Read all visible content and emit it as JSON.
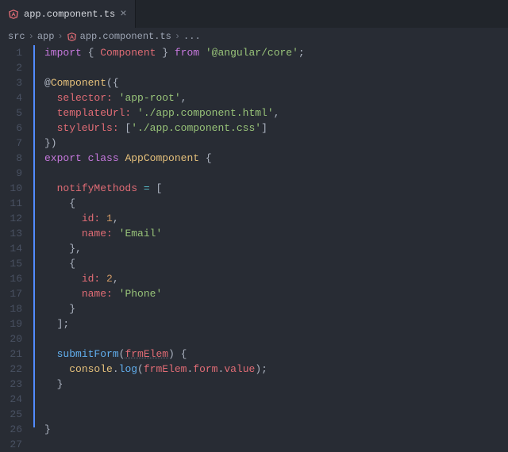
{
  "tab": {
    "filename": "app.component.ts"
  },
  "breadcrumb": {
    "seg1": "src",
    "seg2": "app",
    "seg3": "app.component.ts",
    "more": "..."
  },
  "lines": {
    "l1": {
      "a": "import",
      "b": " { ",
      "c": "Component",
      "d": " } ",
      "e": "from",
      "f": " ",
      "g": "'@angular/core'",
      "h": ";"
    },
    "l3": {
      "a": "@",
      "b": "Component",
      "c": "({"
    },
    "l4": {
      "a": "  selector:",
      "b": " ",
      "c": "'app-root'",
      "d": ","
    },
    "l5": {
      "a": "  templateUrl:",
      "b": " ",
      "c": "'./app.component.html'",
      "d": ","
    },
    "l6": {
      "a": "  styleUrls:",
      "b": " [",
      "c": "'./app.component.css'",
      "d": "]"
    },
    "l7": {
      "a": "})"
    },
    "l8": {
      "a": "export",
      "b": " ",
      "c": "class",
      "d": " ",
      "e": "AppComponent",
      "f": " {"
    },
    "l10": {
      "a": "  ",
      "b": "notifyMethods",
      "c": " ",
      "d": "=",
      "e": " ["
    },
    "l11": {
      "a": "    {"
    },
    "l12": {
      "a": "      ",
      "b": "id:",
      "c": " ",
      "d": "1",
      "e": ","
    },
    "l13": {
      "a": "      ",
      "b": "name:",
      "c": " ",
      "d": "'Email'"
    },
    "l14": {
      "a": "    },"
    },
    "l15": {
      "a": "    {"
    },
    "l16": {
      "a": "      ",
      "b": "id:",
      "c": " ",
      "d": "2",
      "e": ","
    },
    "l17": {
      "a": "      ",
      "b": "name:",
      "c": " ",
      "d": "'Phone'"
    },
    "l18": {
      "a": "    }"
    },
    "l19": {
      "a": "  ];"
    },
    "l21": {
      "a": "  ",
      "b": "submitForm",
      "c": "(",
      "d": "frmElem",
      "e": ") {"
    },
    "l22": {
      "a": "    ",
      "b": "console",
      "c": ".",
      "d": "log",
      "e": "(",
      "f": "frmElem",
      "g": ".",
      "h": "form",
      "i": ".",
      "j": "value",
      "k": ");"
    },
    "l23": {
      "a": "  }"
    },
    "l26": {
      "a": "}"
    }
  },
  "line_count": 27
}
